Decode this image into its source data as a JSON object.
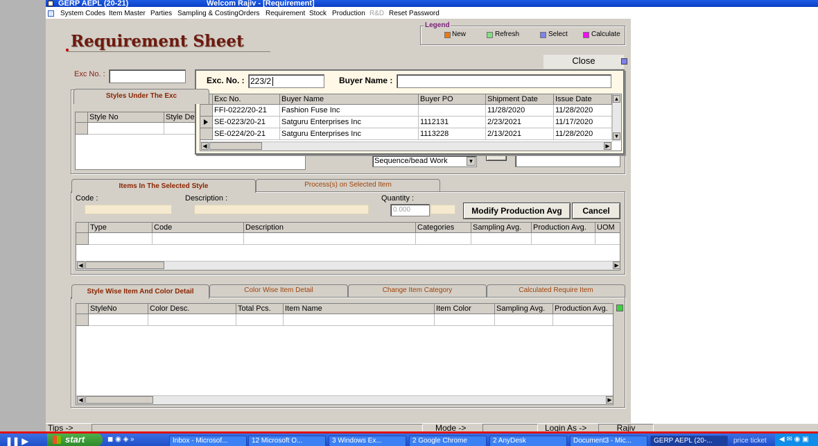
{
  "window": {
    "title_left": "GERP  AEPL  (20-21)",
    "title_center": "Welcom Rajiv - [Requirement]"
  },
  "menu": [
    {
      "label": "System Codes",
      "enabled": true
    },
    {
      "label": "Item Master",
      "enabled": true
    },
    {
      "label": "Parties",
      "enabled": true
    },
    {
      "label": "Sampling & Costing",
      "enabled": true
    },
    {
      "label": "Orders",
      "enabled": true
    },
    {
      "label": "Requirement",
      "enabled": true
    },
    {
      "label": "Stock",
      "enabled": true
    },
    {
      "label": "Production",
      "enabled": true
    },
    {
      "label": "R&D",
      "enabled": false
    },
    {
      "label": "Reset Password",
      "enabled": true
    }
  ],
  "page": {
    "title": "Requirement Sheet",
    "close_label": "Close"
  },
  "legend": {
    "title": "Legend",
    "items": [
      {
        "label": "New",
        "color": "#f07810"
      },
      {
        "label": "Refresh",
        "color": "#80e080"
      },
      {
        "label": "Select",
        "color": "#8080f0"
      },
      {
        "label": "Calculate",
        "color": "#f010f0"
      }
    ]
  },
  "exc": {
    "label": "Exc No. :",
    "value": ""
  },
  "styles_box": {
    "title": "Styles Under The Exc",
    "columns": [
      "Style No",
      "Style De"
    ],
    "process_value": "Sequence/bead Work",
    "arrow_label": "<<"
  },
  "popup": {
    "exc_label": "Exc. No. :",
    "exc_value": "223/2",
    "buyer_label": "Buyer Name :",
    "buyer_value": "",
    "columns": [
      "Exc No.",
      "Buyer Name",
      "Buyer PO",
      "Shipment Date",
      "Issue Date"
    ],
    "rows": [
      {
        "exc_no": "FFI-0222/20-21",
        "buyer": "Fashion Fuse Inc",
        "po": "",
        "ship": "11/28/2020",
        "issue": "11/28/2020",
        "current": false
      },
      {
        "exc_no": "SE-0223/20-21",
        "buyer": "Satguru Enterprises Inc",
        "po": "1112131",
        "ship": "2/23/2021",
        "issue": "11/17/2020",
        "current": true
      },
      {
        "exc_no": "SE-0224/20-21",
        "buyer": "Satguru Enterprises Inc",
        "po": "1113228",
        "ship": "2/13/2021",
        "issue": "11/28/2020",
        "current": false
      }
    ]
  },
  "items_section": {
    "tabs": [
      "Items In The Selected Style",
      "Process(s) on Selected Item"
    ],
    "code_label": "Code :",
    "desc_label": "Description :",
    "qty_label": "Quantity :",
    "qty_value": "0.000",
    "modify_label": "Modify Production Avg",
    "cancel_label": "Cancel",
    "columns": [
      "Type",
      "Code",
      "Description",
      "Categories",
      "Sampling Avg.",
      "Production Avg.",
      "UOM"
    ]
  },
  "detail_section": {
    "tabs": [
      "Style Wise Item And Color Detail",
      "Color Wise Item Detail",
      "Change Item Category",
      "Calculated Require Item"
    ],
    "columns": [
      "StyleNo",
      "Color Desc.",
      "Total Pcs.",
      "Item Name",
      "Item Color",
      "Sampling Avg.",
      "Production Avg."
    ]
  },
  "status": {
    "tips": "Tips ->",
    "mode": "Mode ->",
    "login": "Login As ->",
    "user": "Rajiv"
  },
  "taskbar": {
    "start": "start",
    "tasks": [
      "Inbox - Microsof...",
      "12 Microsoft O...",
      "3 Windows Ex...",
      "2 Google Chrome",
      "2 AnyDesk",
      "Document3 - Mic...",
      "GERP  AEPL  (20-...",
      "price ticket"
    ]
  }
}
